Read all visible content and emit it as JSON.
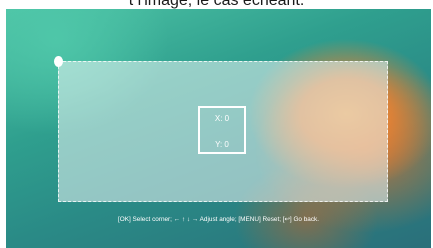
{
  "caption": "t l'image, le cas échéant.",
  "keystone": {
    "x_label": "X: 0",
    "y_label": "Y: 0"
  },
  "hint": "[OK] Select corner; ← ↑ ↓ → Adjust angle; [MENU] Reset; [↩] Go back."
}
